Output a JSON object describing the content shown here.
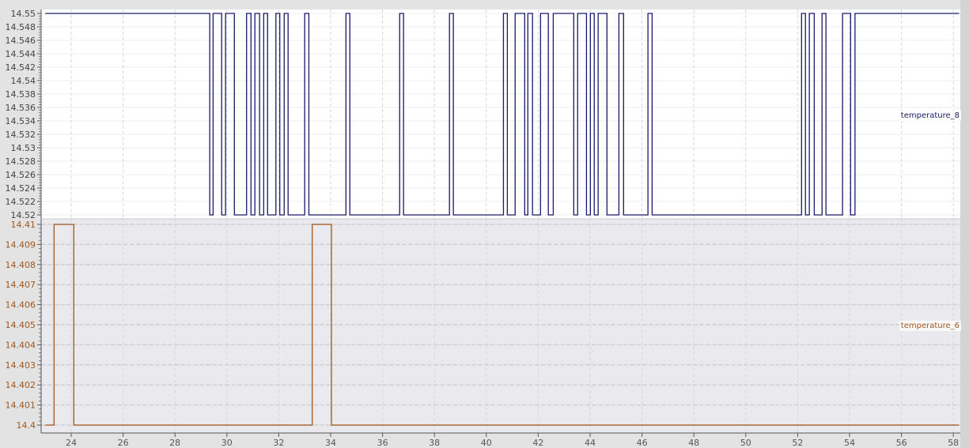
{
  "chart_data": [
    {
      "type": "line",
      "step": true,
      "title": "",
      "series_name": "temperature_8",
      "color": "#1a1a6e",
      "panel_background": "#ffffff",
      "legend_placement": "right",
      "xlim": [
        23.0,
        58.3
      ],
      "ylim": [
        14.52,
        14.55
      ],
      "y_ticks": [
        "14.52",
        "14.522",
        "14.524",
        "14.526",
        "14.528",
        "14.53",
        "14.532",
        "14.534",
        "14.536",
        "14.538",
        "14.54",
        "14.542",
        "14.544",
        "14.546",
        "14.548",
        "14.55"
      ],
      "grid": true,
      "start_value": 14.55,
      "low_value": 14.52,
      "high_value": 14.55,
      "end_x": 58.22,
      "transitions_x": [
        29.34,
        29.47,
        29.8,
        29.95,
        30.29,
        30.76,
        30.93,
        31.08,
        31.26,
        31.42,
        31.57,
        31.89,
        32.04,
        32.21,
        32.36,
        33.0,
        33.16,
        34.59,
        34.74,
        36.66,
        36.81,
        38.58,
        38.73,
        40.66,
        40.81,
        41.11,
        41.48,
        41.6,
        41.78,
        42.09,
        42.39,
        42.58,
        43.37,
        43.52,
        43.86,
        44.01,
        44.16,
        44.31,
        44.65,
        45.11,
        45.29,
        46.23,
        46.39,
        52.15,
        52.3,
        52.45,
        52.64,
        52.94,
        53.09,
        53.73,
        54.04,
        54.21
      ]
    },
    {
      "type": "line",
      "step": true,
      "title": "",
      "series_name": "temperature_6",
      "color": "#a0561c",
      "panel_background": "#e9e9ee",
      "legend_placement": "right",
      "xlim": [
        23.0,
        58.3
      ],
      "ylim": [
        14.4,
        14.41
      ],
      "y_ticks": [
        "14.4",
        "14.401",
        "14.402",
        "14.403",
        "14.404",
        "14.405",
        "14.406",
        "14.407",
        "14.408",
        "14.409",
        "14.41"
      ],
      "grid": true,
      "start_value": 14.4,
      "low_value": 14.4,
      "high_value": 14.41,
      "end_x": 58.22,
      "transitions_x": [
        23.34,
        24.1,
        33.29,
        34.03
      ]
    }
  ],
  "x_axis": {
    "xlabel": "",
    "x_ticks": [
      "24",
      "26",
      "28",
      "30",
      "32",
      "34",
      "36",
      "38",
      "40",
      "42",
      "44",
      "46",
      "48",
      "50",
      "52",
      "54",
      "56",
      "58"
    ]
  }
}
